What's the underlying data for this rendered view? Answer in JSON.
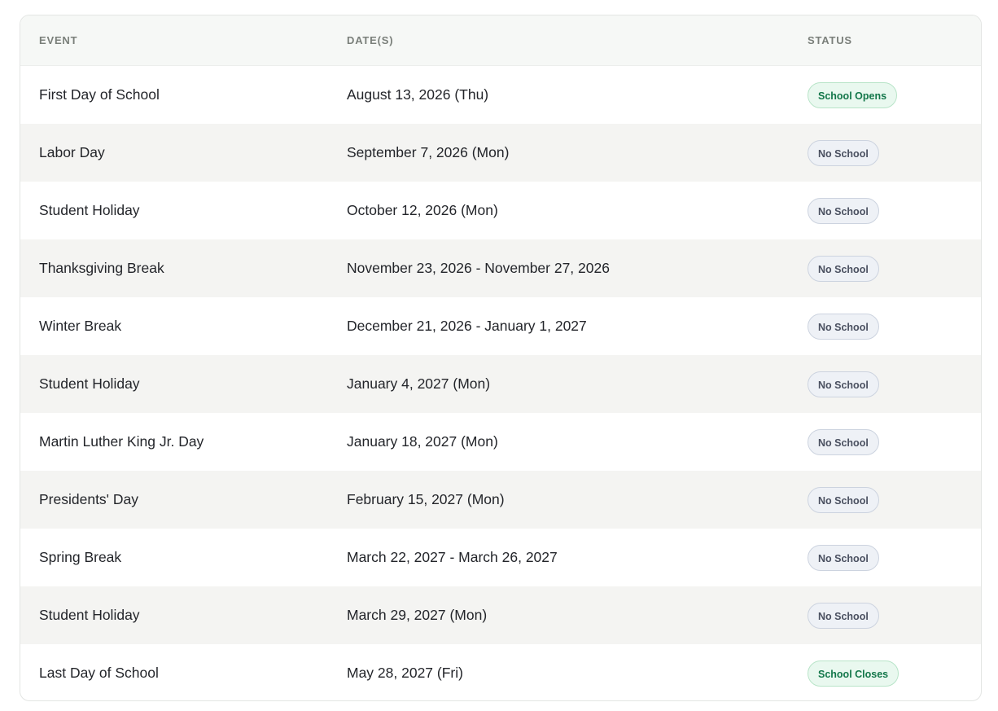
{
  "table": {
    "headers": {
      "event": "EVENT",
      "dates": "DATE(S)",
      "status": "STATUS"
    },
    "rows": [
      {
        "event": "First Day of School",
        "dates": "August 13, 2026 (Thu)",
        "status": "School Opens",
        "status_type": "open"
      },
      {
        "event": "Labor Day",
        "dates": "September 7, 2026 (Mon)",
        "status": "No School",
        "status_type": "closed"
      },
      {
        "event": "Student Holiday",
        "dates": "October 12, 2026 (Mon)",
        "status": "No School",
        "status_type": "closed"
      },
      {
        "event": "Thanksgiving Break",
        "dates": "November 23, 2026 - November 27, 2026",
        "status": "No School",
        "status_type": "closed"
      },
      {
        "event": "Winter Break",
        "dates": "December 21, 2026 - January 1, 2027",
        "status": "No School",
        "status_type": "closed"
      },
      {
        "event": "Student Holiday",
        "dates": "January 4, 2027 (Mon)",
        "status": "No School",
        "status_type": "closed"
      },
      {
        "event": "Martin Luther King Jr. Day",
        "dates": "January 18, 2027 (Mon)",
        "status": "No School",
        "status_type": "closed"
      },
      {
        "event": "Presidents' Day",
        "dates": "February 15, 2027 (Mon)",
        "status": "No School",
        "status_type": "closed"
      },
      {
        "event": "Spring Break",
        "dates": "March 22, 2027 - March 26, 2027",
        "status": "No School",
        "status_type": "closed"
      },
      {
        "event": "Student Holiday",
        "dates": "March 29, 2027 (Mon)",
        "status": "No School",
        "status_type": "closed"
      },
      {
        "event": "Last Day of School",
        "dates": "May 28, 2027 (Fri)",
        "status": "School Closes",
        "status_type": "open"
      }
    ]
  },
  "colors": {
    "open_badge_text": "#13774a",
    "open_badge_bg": "#e9f8ef",
    "closed_badge_text": "#4a5060",
    "closed_badge_bg": "#eef1f6",
    "alt_row_bg": "#f4f4f2",
    "header_bg": "#f6f8f6"
  }
}
